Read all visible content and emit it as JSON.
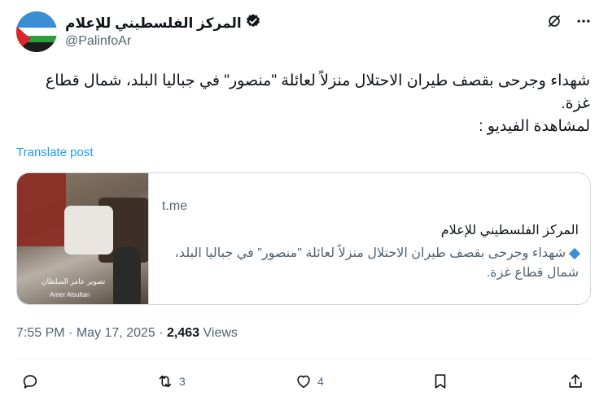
{
  "header": {
    "display_name": "المركز الفلسطيني للإعلام",
    "handle": "@PalinfoAr",
    "icons": [
      "verified-badge-icon",
      "grok-icon",
      "more-icon"
    ]
  },
  "tweet": {
    "lines": [
      "شهداء وجرحى بقصف طيران الاحتلال منزلاً لعائلة \"منصور\" في جباليا البلد، شمال قطاع غزة.",
      "لمشاهدة الفيديو :"
    ],
    "translate_label": "Translate post"
  },
  "card": {
    "domain": "t.me",
    "title": "المركز الفلسطيني للإعلام",
    "description": "شهداء وجرحى بقصف طيران الاحتلال منزلاً لعائلة \"منصور\" في جباليا البلد، شمال قطاع غزة.",
    "thumb_caption_ar": "تصوير عامر السلطان",
    "thumb_caption_en": "Amer Alsultan"
  },
  "meta": {
    "time": "7:55 PM",
    "date": "May 17, 2025",
    "views_count": "2,463",
    "views_label": "Views"
  },
  "actions": {
    "reply_count": "",
    "repost_count": "3",
    "like_count": "4"
  },
  "colors": {
    "accent": "#1d9bf0",
    "muted": "#536471",
    "text": "#0f1419"
  }
}
